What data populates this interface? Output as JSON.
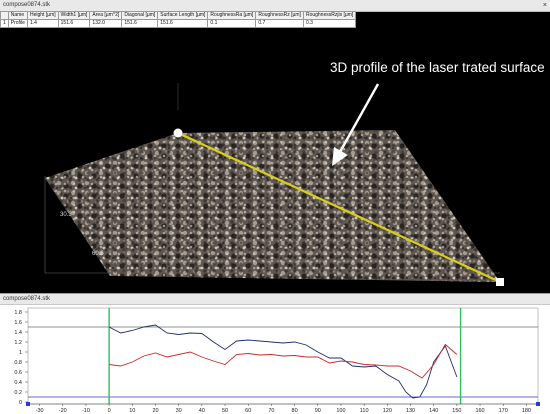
{
  "top_window": {
    "title": "compose0874.stk",
    "close_glyph": "×"
  },
  "measurement_table": {
    "headers": [
      "",
      "Name",
      "Height [µm]",
      "Width1 [µm]",
      "Area [µm^2]",
      "Diagonal [µm]",
      "Surface Length [µm]",
      "RoughnessRa [µm]",
      "RoughnessRz [µm]",
      "RoughnessRzjis [µm]"
    ],
    "rows": [
      [
        "1",
        "Profile",
        "1.4",
        "151.6",
        "132.0",
        "151.6",
        "151.6",
        "0.1",
        "0.7",
        "0.3"
      ]
    ]
  },
  "view3d": {
    "annotation": "3D profile of the laser trated surface",
    "axis_label_a": "30.3",
    "axis_label_b": "60.6",
    "start_marker_icon": "circle-handle-icon",
    "end_marker_icon": "square-handle-icon",
    "arrow_icon": "annotation-arrow-icon",
    "colors": {
      "profile_line": "#d8cf1a",
      "annotation": "#ffffff"
    }
  },
  "bottom_window": {
    "title": "compose0874.stk"
  },
  "chart_data": {
    "type": "line",
    "x_ticks": [
      -30,
      -20,
      -10,
      0,
      10,
      20,
      30,
      40,
      50,
      60,
      70,
      80,
      90,
      100,
      110,
      120,
      130,
      140,
      150,
      160,
      170,
      180
    ],
    "y_ticks": [
      "1.8",
      "1.6",
      "1.4",
      "1.2",
      "1",
      "0.8",
      "0.6",
      "0.4",
      "0.2",
      "0"
    ],
    "xlim": [
      -35,
      185
    ],
    "ylim": [
      0,
      1.8
    ],
    "series": [
      {
        "color": "#1f2f6b",
        "x": [
          0,
          5,
          10,
          15,
          20,
          25,
          30,
          35,
          40,
          45,
          50,
          55,
          60,
          65,
          70,
          75,
          80,
          85,
          90,
          95,
          100,
          105,
          110,
          115,
          120,
          125,
          128,
          131,
          134,
          137,
          140,
          145,
          150
        ],
        "y": [
          1.5,
          1.38,
          1.43,
          1.5,
          1.54,
          1.38,
          1.35,
          1.38,
          1.37,
          1.2,
          1.05,
          1.22,
          1.24,
          1.22,
          1.2,
          1.18,
          1.2,
          1.14,
          1.0,
          0.88,
          0.88,
          0.72,
          0.7,
          0.72,
          0.55,
          0.42,
          0.2,
          0.08,
          0.1,
          0.35,
          0.8,
          1.12,
          0.5
        ]
      },
      {
        "color": "#cc2a2a",
        "x": [
          0,
          5,
          10,
          15,
          20,
          25,
          30,
          35,
          40,
          45,
          50,
          55,
          60,
          65,
          70,
          75,
          80,
          85,
          90,
          95,
          100,
          105,
          110,
          115,
          120,
          125,
          130,
          135,
          140,
          145,
          150
        ],
        "y": [
          0.75,
          0.72,
          0.8,
          0.92,
          0.98,
          0.9,
          0.95,
          1.0,
          0.9,
          0.82,
          0.75,
          0.95,
          0.97,
          0.94,
          0.95,
          0.92,
          0.93,
          0.9,
          0.9,
          0.78,
          0.82,
          0.8,
          0.75,
          0.74,
          0.72,
          0.72,
          0.62,
          0.48,
          0.75,
          1.15,
          0.95
        ]
      }
    ],
    "reference_lines": {
      "upper_y": 1.5,
      "lower_y": 0.1,
      "left_marker_x": 0,
      "right_marker_x": 151.6
    },
    "colors": {
      "marker_lines": "#2fc060",
      "upper_ref": "#222222",
      "lower_ref": "#2a3cc0"
    }
  }
}
